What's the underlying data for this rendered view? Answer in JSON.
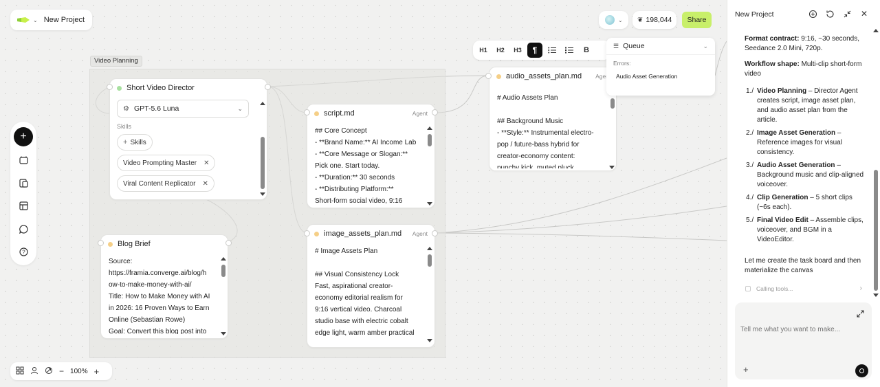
{
  "project": {
    "name": "New Project"
  },
  "top_right": {
    "credits": "198,044",
    "share_label": "Share"
  },
  "canvas": {
    "group_label": "Video Planning",
    "zoom": "100%"
  },
  "nodes": {
    "director": {
      "title": "Short Video Director",
      "model": "GPT-5.6 Luna",
      "skills_label": "Skills",
      "add_skills_label": "Skills",
      "skills": [
        "Video Prompting Master",
        "Viral Content Replicator"
      ]
    },
    "blog": {
      "title": "Blog Brief",
      "body": "Source:\nhttps://framia.converge.ai/blog/h\now-to-make-money-with-ai/\nTitle: How to Make Money with AI\nin 2026: 16 Proven Ways to Earn\nOnline (Sebastian Rowe)\nGoal: Convert this blog post into"
    },
    "script": {
      "title": "script.md",
      "badge": "Agent",
      "body": "## Core Concept\n- **Brand Name:** AI Income Lab\n- **Core Message or Slogan:**\nPick one. Start today.\n- **Duration:** 30 seconds\n- **Distributing Platform:**\nShort-form social video, 9:16"
    },
    "image_assets": {
      "title": "image_assets_plan.md",
      "badge": "Agent",
      "body": "# Image Assets Plan\n\n## Visual Consistency Lock\nFast, aspirational creator-\neconomy editorial realism for\n9:16 vertical video. Charcoal\nstudio base with electric cobalt\nedge light, warm amber practical"
    },
    "audio_assets": {
      "title": "audio_assets_plan.md",
      "badge": "Agen",
      "body": "# Audio Assets Plan\n\n## Background Music\n- **Style:** Instrumental electro-\npop / future-bass hybrid for\ncreator-economy content:\npunchy kick, muted pluck"
    }
  },
  "toolbar": {
    "h1": "H1",
    "h2": "H2",
    "h3": "H3",
    "paragraph": "¶",
    "bold": "B"
  },
  "queue": {
    "title": "Queue",
    "errors_label": "Errors:",
    "errors": [
      "Audio Asset Generation"
    ]
  },
  "panel": {
    "title": "New Project",
    "format_bold": "Format contract:",
    "format_text": " 9:16, ~30 seconds, Seedance 2.0 Mini, 720p.",
    "workflow_bold": "Workflow shape:",
    "workflow_text": " Multi-clip short-form video",
    "steps": [
      {
        "num": "1./",
        "title": "Video Planning",
        "text": " – Director Agent creates script, image asset plan, and audio asset plan from the article."
      },
      {
        "num": "2./",
        "title": "Image Asset Generation",
        "text": " – Reference images for visual consistency."
      },
      {
        "num": "3./",
        "title": "Audio Asset Generation",
        "text": " – Background music and clip-aligned voiceover."
      },
      {
        "num": "4./",
        "title": "Clip Generation",
        "text": " – 5 short clips (~6s each)."
      },
      {
        "num": "5./",
        "title": "Final Video Edit",
        "text": " – Assemble clips, voiceover, and BGM in a VideoEditor."
      }
    ],
    "closing": "Let me create the task board and then materialize the canvas",
    "calling": "Calling tools...",
    "input_placeholder": "Tell me what you want to make..."
  },
  "colors": {
    "accent_green": "#c8ef6a",
    "brand_lime": "#c8f04a"
  }
}
